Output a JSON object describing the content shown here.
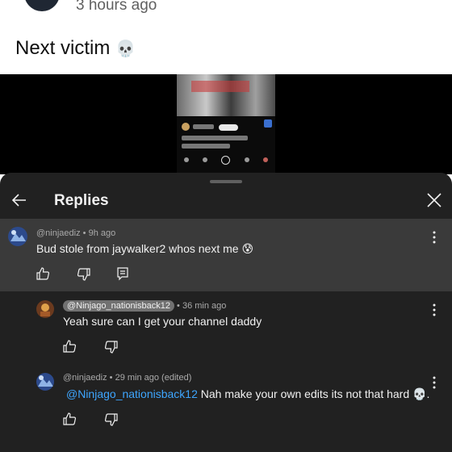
{
  "post": {
    "time": "3 hours ago",
    "text": "Next victim",
    "emoji": "💀"
  },
  "panel": {
    "title": "Replies"
  },
  "comments": [
    {
      "author": "@ninjaediz",
      "time": "9h ago",
      "text": "Bud stole from jaywalker2 whos next me",
      "emoji": "😰"
    },
    {
      "author": "@Ninjago_nationisback12",
      "time": "36 min ago",
      "text": "Yeah sure can I get your channel daddy"
    },
    {
      "author": "@ninjaediz",
      "time": "29 min ago (edited)",
      "mention": "@Ninjago_nationisback12",
      "text": "Nah make your own edits its not that hard",
      "emoji": "💀",
      "suffix": "."
    }
  ],
  "icons": {
    "back": "arrow-left-icon",
    "close": "close-icon",
    "more": "more-vertical-icon",
    "like": "thumb-up-icon",
    "dislike": "thumb-down-icon",
    "reply": "comment-icon"
  },
  "colors": {
    "panel_bg": "#212121",
    "highlight_bg": "#3a3a3a",
    "link": "#3ea6ff"
  }
}
